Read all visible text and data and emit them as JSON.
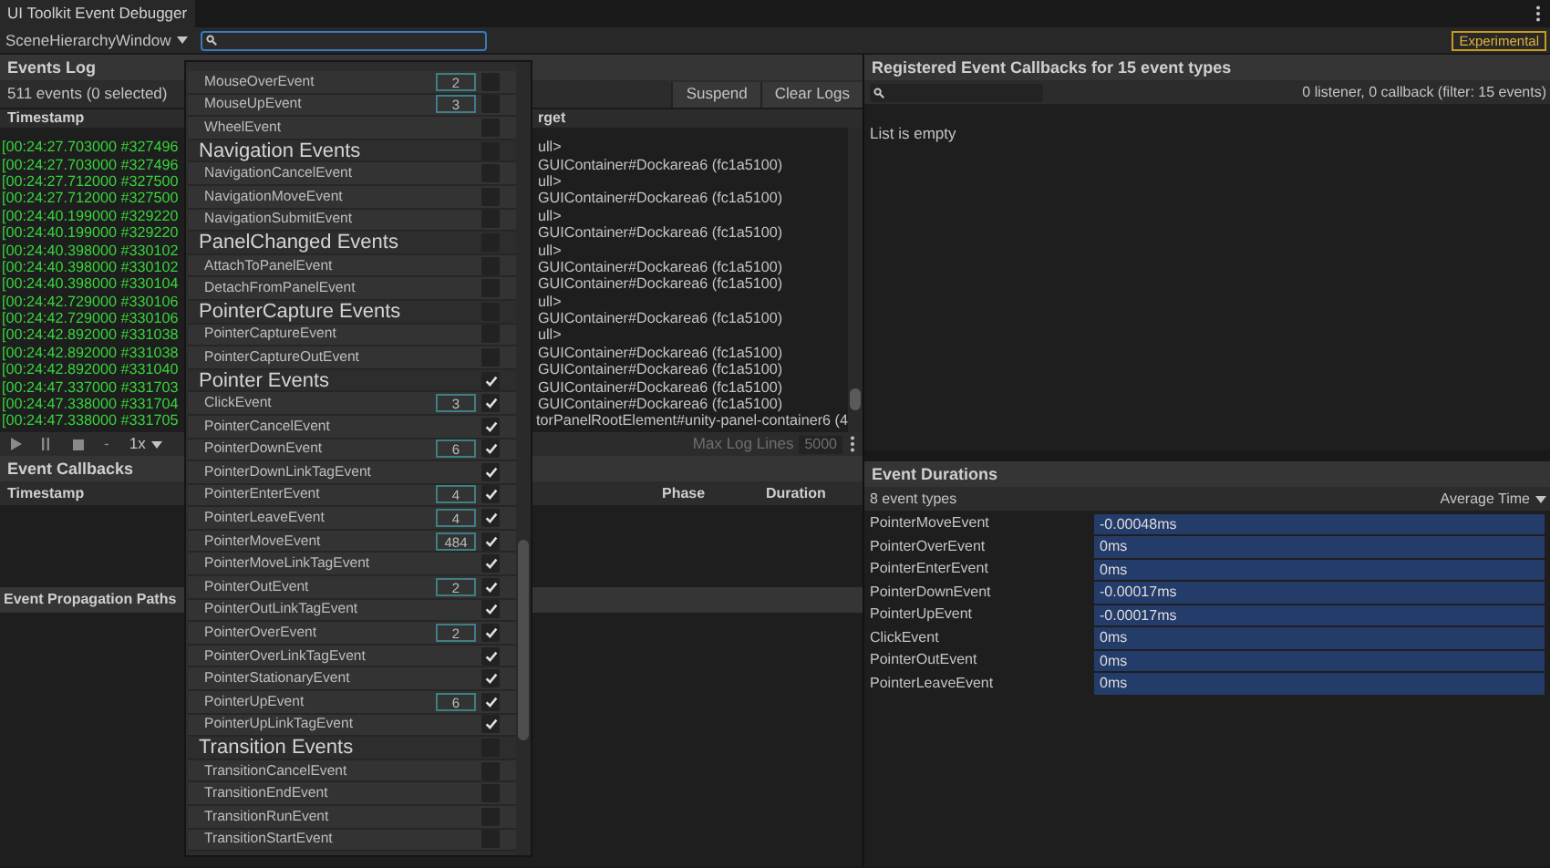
{
  "window": {
    "title": "UI Toolkit Event Debugger"
  },
  "toolbar": {
    "panel_selector": "SceneHierarchyWindow",
    "badge": "Experimental"
  },
  "events_log": {
    "title": "Events Log",
    "summary": "511 events (0 selected)",
    "buttons": [
      "Suspend",
      "Clear Logs"
    ],
    "columns": [
      "Timestamp",
      "rget"
    ],
    "rows": [
      {
        "timestamp": "[00:24:27.703000 #327496",
        "target": "ull>"
      },
      {
        "timestamp": "[00:24:27.703000 #327496",
        "target": "GUIContainer#Dockarea6 (fc1a5100)"
      },
      {
        "timestamp": "[00:24:27.712000 #327500",
        "target": "ull>"
      },
      {
        "timestamp": "[00:24:27.712000 #327500",
        "target": "GUIContainer#Dockarea6 (fc1a5100)"
      },
      {
        "timestamp": "[00:24:40.199000 #329220",
        "target": "ull>"
      },
      {
        "timestamp": "[00:24:40.199000 #329220",
        "target": "GUIContainer#Dockarea6 (fc1a5100)"
      },
      {
        "timestamp": "[00:24:40.398000 #330102",
        "target": "ull>"
      },
      {
        "timestamp": "[00:24:40.398000 #330102",
        "target": "GUIContainer#Dockarea6 (fc1a5100)"
      },
      {
        "timestamp": "[00:24:40.398000 #330104",
        "target": "GUIContainer#Dockarea6 (fc1a5100)"
      },
      {
        "timestamp": "[00:24:42.729000 #330106",
        "target": "ull>"
      },
      {
        "timestamp": "[00:24:42.729000 #330106",
        "target": "GUIContainer#Dockarea6 (fc1a5100)"
      },
      {
        "timestamp": "[00:24:42.892000 #331038",
        "target": "ull>"
      },
      {
        "timestamp": "[00:24:42.892000 #331038",
        "target": "GUIContainer#Dockarea6 (fc1a5100)"
      },
      {
        "timestamp": "[00:24:42.892000 #331040",
        "target": "GUIContainer#Dockarea6 (fc1a5100)"
      },
      {
        "timestamp": "[00:24:47.337000 #331703",
        "target": "GUIContainer#Dockarea6 (fc1a5100)"
      },
      {
        "timestamp": "[00:24:47.338000 #331704",
        "target": "GUIContainer#Dockarea6 (fc1a5100)"
      },
      {
        "timestamp": "[00:24:47.338000 #331705",
        "target": "torPanelRootElement#unity-panel-container6 (4"
      }
    ],
    "playback": {
      "step": "-",
      "speed": "1x",
      "max_lines_label": "Max Log Lines",
      "max_lines": "5000"
    }
  },
  "event_callbacks": {
    "title": "Event Callbacks",
    "columns": [
      "Timestamp",
      "Phase",
      "Duration"
    ]
  },
  "propagation": {
    "title": "Event Propagation Paths"
  },
  "registered": {
    "title": "Registered Event Callbacks for 15 event types",
    "summary": "0 listener, 0 callback (filter: 15 events)",
    "empty_text": "List is empty"
  },
  "durations": {
    "title": "Event Durations",
    "summary": "8 event types",
    "sort": "Average Time",
    "rows": [
      {
        "name": "PointerMoveEvent",
        "value": "-0.00048ms"
      },
      {
        "name": "PointerOverEvent",
        "value": "0ms"
      },
      {
        "name": "PointerEnterEvent",
        "value": "0ms"
      },
      {
        "name": "PointerDownEvent",
        "value": "-0.00017ms"
      },
      {
        "name": "PointerUpEvent",
        "value": "-0.00017ms"
      },
      {
        "name": "ClickEvent",
        "value": "0ms"
      },
      {
        "name": "PointerOutEvent",
        "value": "0ms"
      },
      {
        "name": "PointerLeaveEvent",
        "value": "0ms"
      }
    ]
  },
  "filter_menu": {
    "items": [
      {
        "kind": "event",
        "label": "MouseOverEvent",
        "count": "2",
        "checked": false
      },
      {
        "kind": "event",
        "label": "MouseUpEvent",
        "count": "3",
        "checked": false
      },
      {
        "kind": "event",
        "label": "WheelEvent",
        "checked": false
      },
      {
        "kind": "group",
        "label": "Navigation Events",
        "checked": false
      },
      {
        "kind": "event",
        "label": "NavigationCancelEvent",
        "checked": false
      },
      {
        "kind": "event",
        "label": "NavigationMoveEvent",
        "checked": false
      },
      {
        "kind": "event",
        "label": "NavigationSubmitEvent",
        "checked": false
      },
      {
        "kind": "group",
        "label": "PanelChanged Events",
        "checked": false
      },
      {
        "kind": "event",
        "label": "AttachToPanelEvent",
        "checked": false
      },
      {
        "kind": "event",
        "label": "DetachFromPanelEvent",
        "checked": false
      },
      {
        "kind": "group",
        "label": "PointerCapture Events",
        "checked": false
      },
      {
        "kind": "event",
        "label": "PointerCaptureEvent",
        "checked": false
      },
      {
        "kind": "event",
        "label": "PointerCaptureOutEvent",
        "checked": false
      },
      {
        "kind": "group",
        "label": "Pointer Events",
        "checked": true
      },
      {
        "kind": "event",
        "label": "ClickEvent",
        "count": "3",
        "checked": true
      },
      {
        "kind": "event",
        "label": "PointerCancelEvent",
        "checked": true
      },
      {
        "kind": "event",
        "label": "PointerDownEvent",
        "count": "6",
        "checked": true
      },
      {
        "kind": "event",
        "label": "PointerDownLinkTagEvent",
        "checked": true
      },
      {
        "kind": "event",
        "label": "PointerEnterEvent",
        "count": "4",
        "checked": true
      },
      {
        "kind": "event",
        "label": "PointerLeaveEvent",
        "count": "4",
        "checked": true
      },
      {
        "kind": "event",
        "label": "PointerMoveEvent",
        "count": "484",
        "checked": true
      },
      {
        "kind": "event",
        "label": "PointerMoveLinkTagEvent",
        "checked": true
      },
      {
        "kind": "event",
        "label": "PointerOutEvent",
        "count": "2",
        "checked": true
      },
      {
        "kind": "event",
        "label": "PointerOutLinkTagEvent",
        "checked": true
      },
      {
        "kind": "event",
        "label": "PointerOverEvent",
        "count": "2",
        "checked": true
      },
      {
        "kind": "event",
        "label": "PointerOverLinkTagEvent",
        "checked": true
      },
      {
        "kind": "event",
        "label": "PointerStationaryEvent",
        "checked": true
      },
      {
        "kind": "event",
        "label": "PointerUpEvent",
        "count": "6",
        "checked": true
      },
      {
        "kind": "event",
        "label": "PointerUpLinkTagEvent",
        "checked": true
      },
      {
        "kind": "group",
        "label": "Transition Events",
        "checked": false
      },
      {
        "kind": "event",
        "label": "TransitionCancelEvent",
        "checked": false
      },
      {
        "kind": "event",
        "label": "TransitionEndEvent",
        "checked": false
      },
      {
        "kind": "event",
        "label": "TransitionRunEvent",
        "checked": false
      },
      {
        "kind": "event",
        "label": "TransitionStartEvent",
        "checked": false
      }
    ]
  }
}
